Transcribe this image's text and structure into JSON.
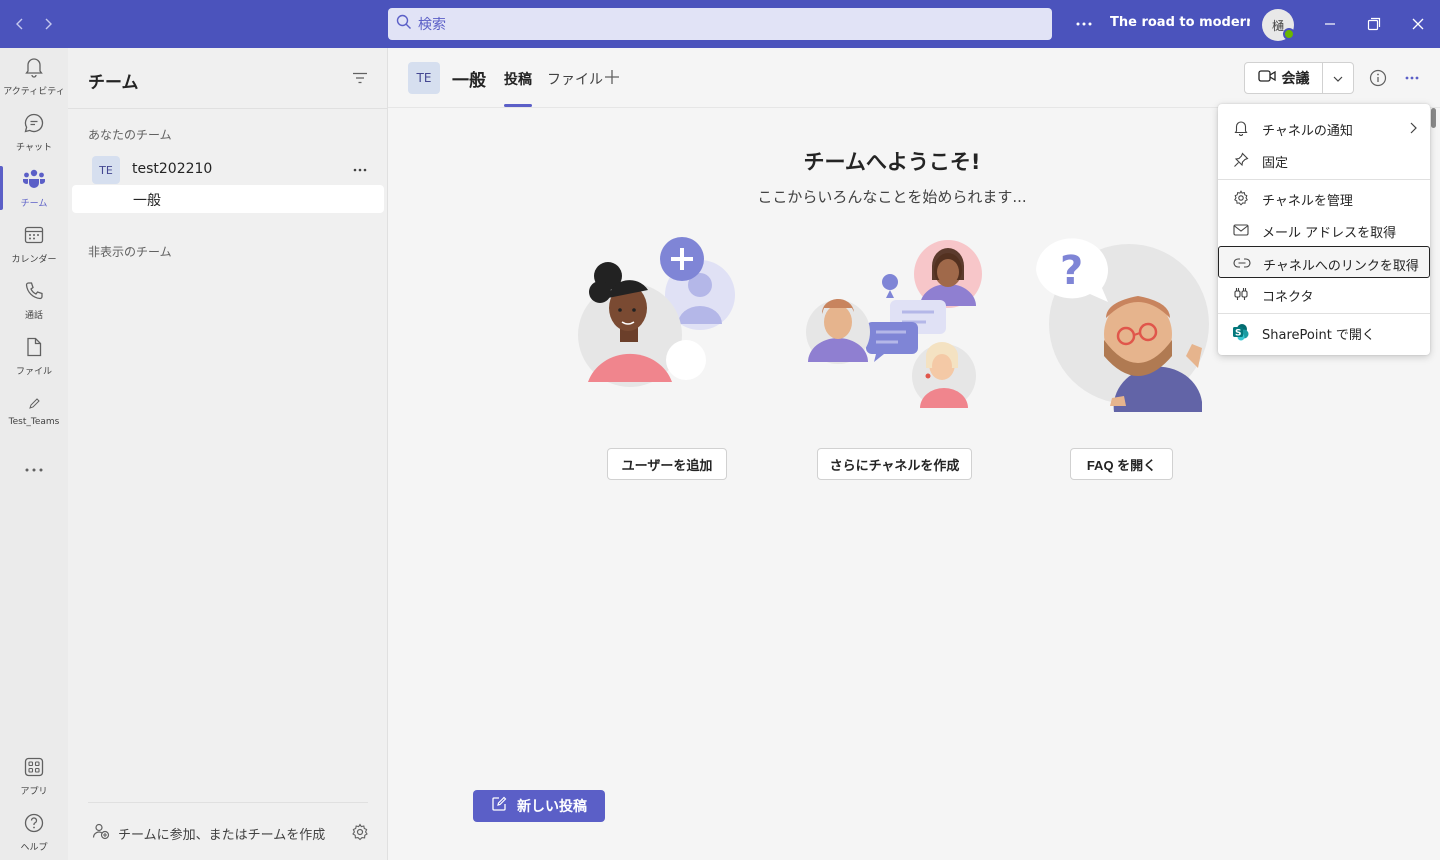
{
  "titlebar": {
    "search_placeholder": "検索",
    "title": "The road to modernizati...",
    "avatar_initial": "樋",
    "more_label": "•••"
  },
  "rail": {
    "items": [
      {
        "label": "アクティビティ",
        "icon": "bell-icon"
      },
      {
        "label": "チャット",
        "icon": "chat-icon"
      },
      {
        "label": "チーム",
        "icon": "teams-icon"
      },
      {
        "label": "カレンダー",
        "icon": "calendar-icon"
      },
      {
        "label": "通話",
        "icon": "phone-icon"
      },
      {
        "label": "ファイル",
        "icon": "file-icon"
      },
      {
        "label": "Test_Teams",
        "icon": "pencil-icon"
      }
    ],
    "bottom_items": [
      {
        "label": "アプリ",
        "icon": "apps-icon"
      },
      {
        "label": "ヘルプ",
        "icon": "help-icon"
      }
    ],
    "active_index": 2
  },
  "teams_panel": {
    "header": "チーム",
    "section_yours": "あなたのチーム",
    "team": {
      "avatar": "TE",
      "name": "test202210"
    },
    "channel": "一般",
    "section_hidden": "非表示のチーム",
    "join_label": "チームに参加、またはチームを作成"
  },
  "channel_header": {
    "avatar": "TE",
    "name": "一般",
    "tabs": [
      "投稿",
      "ファイル"
    ],
    "active_tab": "投稿",
    "meet_label": "会議"
  },
  "main": {
    "welcome_title": "チームへようこそ!",
    "welcome_subtitle": "ここからいろんなことを始められます...",
    "actions": [
      "ユーザーを追加",
      "さらにチャネルを作成",
      "FAQ を開く"
    ],
    "new_post": "新しい投稿"
  },
  "menu": {
    "items": [
      {
        "label": "チャネルの通知",
        "icon": "bell-icon",
        "submenu": true
      },
      {
        "label": "固定",
        "icon": "pin-icon"
      },
      {
        "label": "チャネルを管理",
        "icon": "gear-icon"
      },
      {
        "label": "メール アドレスを取得",
        "icon": "mail-icon"
      },
      {
        "label": "チャネルへのリンクを取得",
        "icon": "link-icon",
        "focused": true
      },
      {
        "label": "コネクタ",
        "icon": "connector-icon"
      },
      {
        "label": "SharePoint で開く",
        "icon": "sharepoint-icon"
      }
    ]
  },
  "colors": {
    "brand": "#4b53bc",
    "accent": "#5b5fc7",
    "status_available": "#6bb700"
  }
}
